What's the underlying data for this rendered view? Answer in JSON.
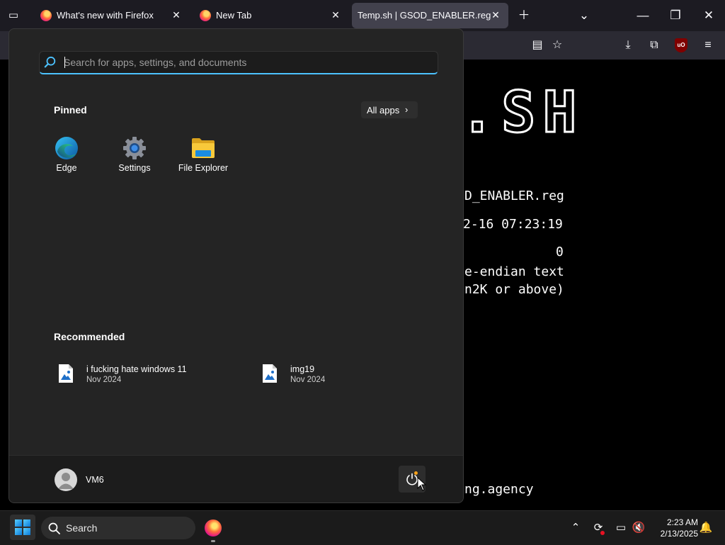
{
  "browser": {
    "tabs": [
      {
        "title": "What's new with Firefox"
      },
      {
        "title": "New Tab"
      },
      {
        "title": "Temp.sh | GSOD_ENABLER.reg"
      }
    ]
  },
  "terminal": {
    "banner": ".SH",
    "lines": [
      "D_ENABLER.reg",
      "2-16 07:23:19",
      "0",
      "e-endian text",
      "n2K or above)",
      "ng.agency"
    ]
  },
  "start_menu": {
    "search_placeholder": "Search for apps, settings, and documents",
    "pinned_title": "Pinned",
    "all_apps_label": "All apps",
    "pinned": [
      {
        "label": "Edge",
        "icon": "edge-icon"
      },
      {
        "label": "Settings",
        "icon": "gear-icon"
      },
      {
        "label": "File Explorer",
        "icon": "folder-icon"
      }
    ],
    "recommended_title": "Recommended",
    "recommended": [
      {
        "name": "i fucking hate windows 11",
        "date": "Nov 2024",
        "icon": "image-file-icon"
      },
      {
        "name": "img19",
        "date": "Nov 2024",
        "icon": "image-file-icon"
      }
    ],
    "user": {
      "name": "VM6"
    }
  },
  "taskbar": {
    "search_label": "Search",
    "time": "2:23 AM",
    "date": "2/13/2025"
  },
  "colors": {
    "accent": "#4cc2ff",
    "start_bg": "#242424",
    "taskbar_bg": "#1b1b1b",
    "tab_active": "#42414d"
  }
}
